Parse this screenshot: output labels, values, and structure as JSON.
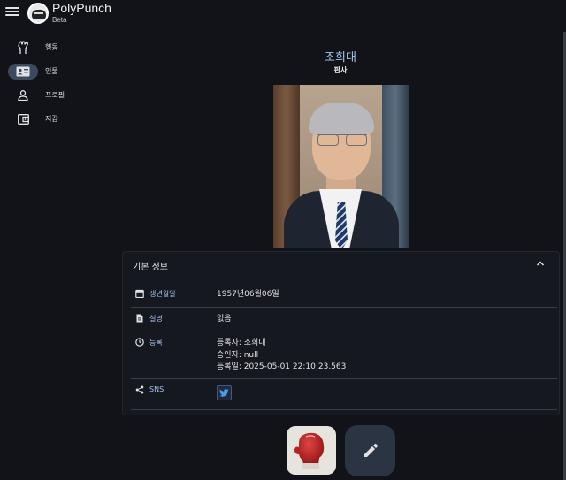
{
  "app": {
    "title": "PolyPunch",
    "subtitle": "Beta"
  },
  "sidebar": {
    "items": [
      {
        "label": "행동",
        "icon": "raised-fist-icon",
        "active": false
      },
      {
        "label": "인물",
        "icon": "id-card-icon",
        "active": true
      },
      {
        "label": "프로필",
        "icon": "person-icon",
        "active": false
      },
      {
        "label": "지갑",
        "icon": "wallet-icon",
        "active": false
      }
    ]
  },
  "person": {
    "name": "조희대",
    "role": "판사"
  },
  "info_card": {
    "title": "기본 정보",
    "rows": [
      {
        "label": "생년월일",
        "icon": "calendar-icon",
        "lines": [
          "1957년06월06일"
        ]
      },
      {
        "label": "설명",
        "icon": "document-icon",
        "lines": [
          "없음"
        ]
      },
      {
        "label": "등록",
        "icon": "clock-icon",
        "lines": [
          "등록자: 조희대",
          "승인자: null",
          "등록일: 2025-05-01 22:10:23.563"
        ]
      },
      {
        "label": "SNS",
        "icon": "share-icon",
        "button_icon": "twitter-icon"
      }
    ]
  },
  "colors": {
    "background": "#111318",
    "accent": "#a8c7f0",
    "active_nav": "#3b4a5e",
    "fab": "#2b3442",
    "glove_red": "#c0282a"
  }
}
